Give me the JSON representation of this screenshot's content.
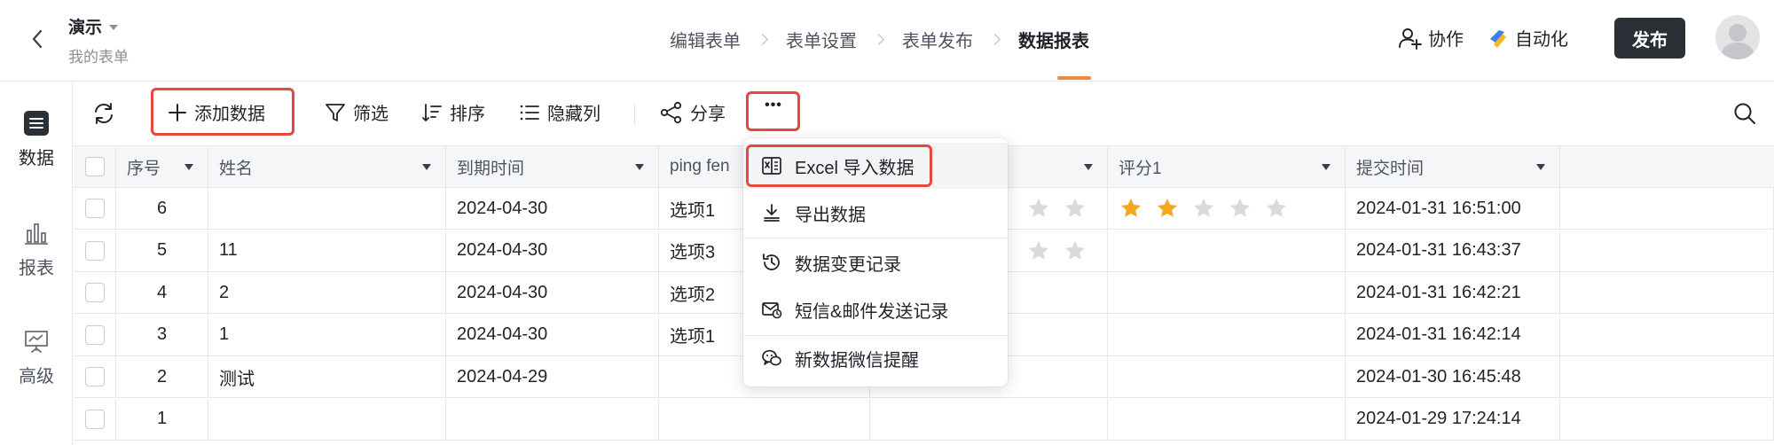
{
  "header": {
    "form_title": "演示",
    "form_subtitle": "我的表单",
    "steps": [
      "编辑表单",
      "表单设置",
      "表单发布",
      "数据报表"
    ],
    "active_step": 3,
    "collaborate_label": "协作",
    "automation_label": "自动化",
    "publish_label": "发布"
  },
  "sidebar": {
    "items": [
      {
        "label": "数据",
        "icon": "list-icon",
        "active": true
      },
      {
        "label": "报表",
        "icon": "bar-chart-icon",
        "active": false
      },
      {
        "label": "高级",
        "icon": "presentation-icon",
        "active": false
      }
    ]
  },
  "toolbar": {
    "add_label": "添加数据",
    "filter_label": "筛选",
    "sort_label": "排序",
    "hide_columns_label": "隐藏列",
    "share_label": "分享",
    "more_label": "•••"
  },
  "table": {
    "columns": [
      "序号",
      "姓名",
      "到期时间",
      "ping fen",
      "评分1",
      "提交时间"
    ],
    "rows": [
      {
        "seq": "6",
        "name": "",
        "due": "2024-04-30",
        "ping": "选项1",
        "rating1": 2,
        "submit": "2024-01-31 16:51:00"
      },
      {
        "seq": "5",
        "name": "11",
        "due": "2024-04-30",
        "ping": "选项3",
        "rating1": 0,
        "submit": "2024-01-31 16:43:37"
      },
      {
        "seq": "4",
        "name": "2",
        "due": "2024-04-30",
        "ping": "选项2",
        "rating1": 0,
        "submit": "2024-01-31 16:42:21"
      },
      {
        "seq": "3",
        "name": "1",
        "due": "2024-04-30",
        "ping": "选项1",
        "rating1": 0,
        "submit": "2024-01-31 16:42:14"
      },
      {
        "seq": "2",
        "name": "测试",
        "due": "2024-04-29",
        "ping": "",
        "rating1": 0,
        "submit": "2024-01-30 16:45:48"
      },
      {
        "seq": "1",
        "name": "",
        "due": "",
        "ping": "",
        "rating1": 0,
        "submit": "2024-01-29 17:24:14"
      }
    ]
  },
  "more_menu": {
    "items": [
      {
        "label": "Excel 导入数据",
        "icon": "excel-import-icon"
      },
      {
        "label": "导出数据",
        "icon": "export-icon"
      },
      {
        "label": "数据变更记录",
        "icon": "history-icon"
      },
      {
        "label": "短信&邮件发送记录",
        "icon": "mail-record-icon"
      },
      {
        "label": "新数据微信提醒",
        "icon": "wechat-icon"
      }
    ]
  },
  "colors": {
    "accent": "#f08a3c",
    "highlight_frame": "#e5483f",
    "star_filled": "#f5a623",
    "star_empty": "#d9dadc",
    "publish_bg": "#2b2f36"
  }
}
